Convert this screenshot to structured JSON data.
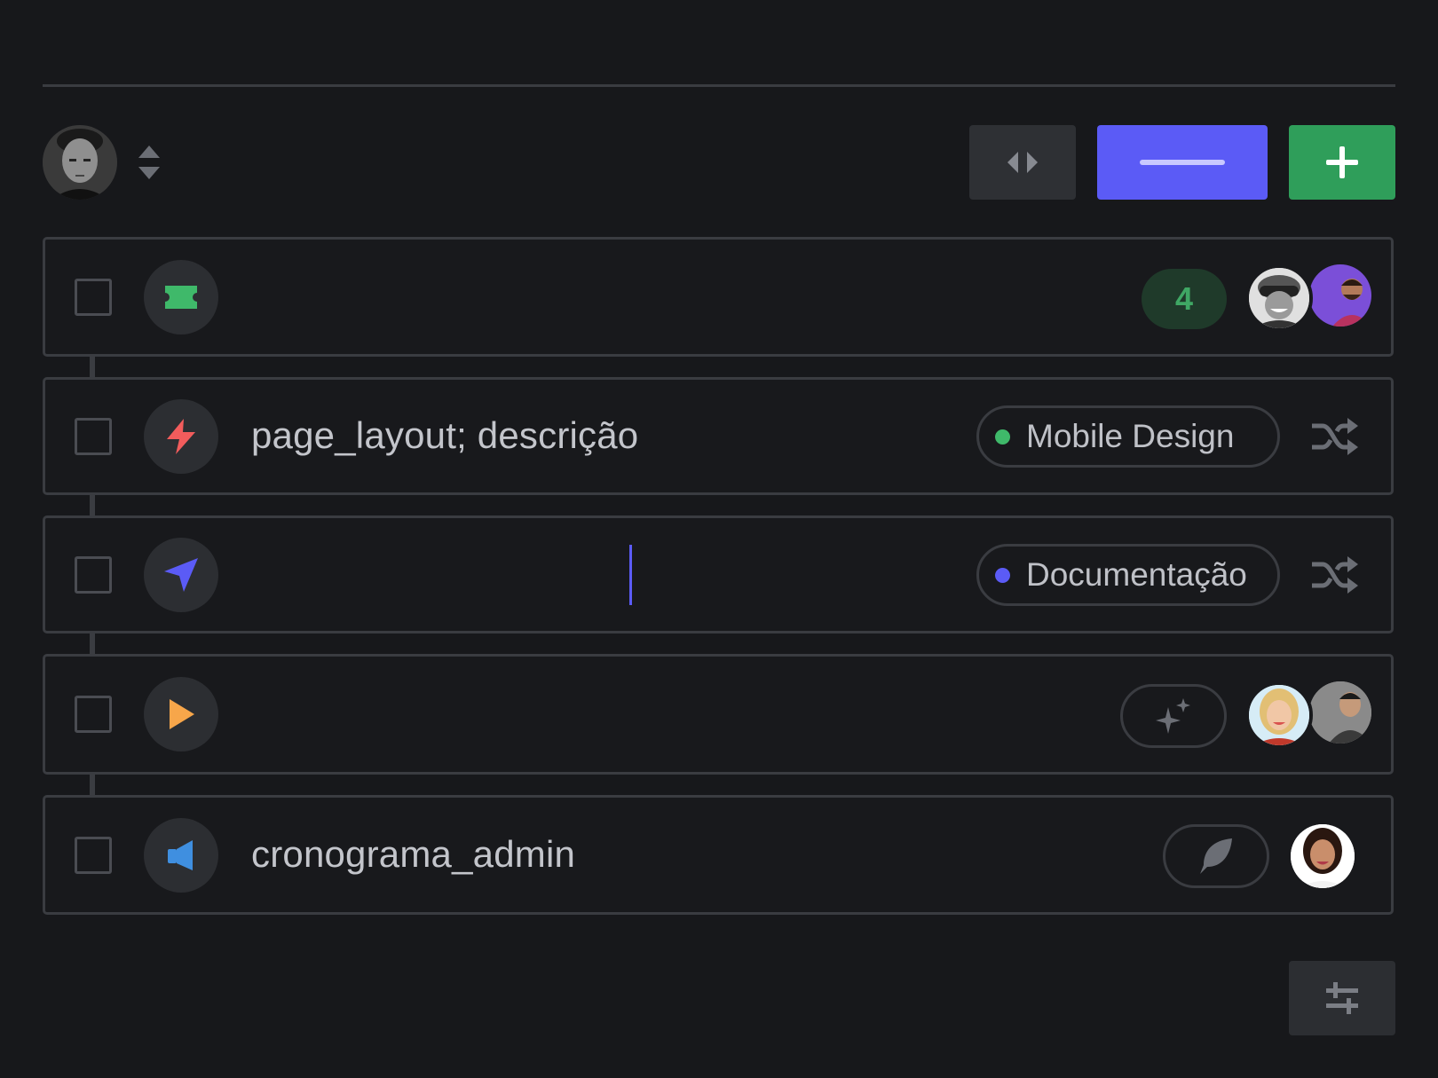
{
  "toolbar": {
    "user_avatar": "user-avatar",
    "sort_icon": "sort-updown-icon",
    "split_button_icon": "split-arrows-icon",
    "primary_button_icon": "minus-icon",
    "add_button_icon": "plus-icon"
  },
  "colors": {
    "background": "#17181b",
    "border": "#3a3c41",
    "primary": "#5b5bf6",
    "success": "#2f9e5a",
    "danger": "#f25c5c",
    "warning": "#f7a64a",
    "info": "#3f8fe0"
  },
  "rows": [
    {
      "icon": "ticket-icon",
      "title": "",
      "count": "4",
      "assignees": [
        "avatar-woman-goggles",
        "avatar-man-beard"
      ]
    },
    {
      "icon": "lightning-icon",
      "title": "page_layout; descrição",
      "tag": {
        "label": "Mobile Design",
        "color": "#3fb96a"
      },
      "action_icon": "shuffle-icon"
    },
    {
      "icon": "send-icon",
      "title": "",
      "tag": {
        "label": "Documentação",
        "color": "#5b5bf6"
      },
      "action_icon": "shuffle-icon"
    },
    {
      "icon": "play-icon",
      "title": "",
      "action_icon": "sparkles-icon",
      "assignees": [
        "avatar-woman-blonde",
        "avatar-man-hoodie"
      ]
    },
    {
      "icon": "megaphone-icon",
      "title": "cronograma_admin",
      "action_icon": "feather-icon",
      "assignees": [
        "avatar-woman-smiling"
      ]
    }
  ],
  "footer": {
    "settings_icon": "sliders-icon"
  }
}
